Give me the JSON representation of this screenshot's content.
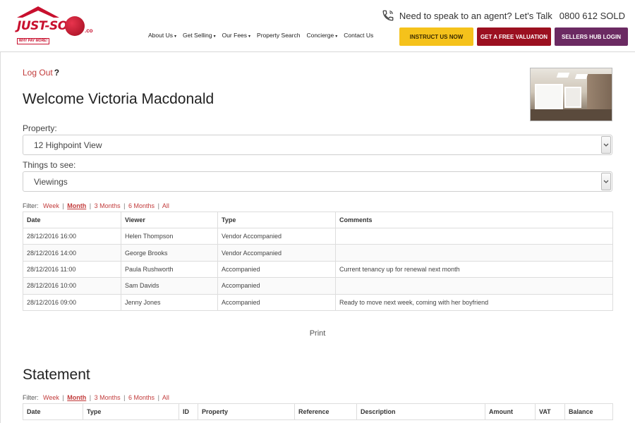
{
  "header": {
    "logo": {
      "brand": "JUST-SOLD",
      "suffix": ".co",
      "tagline": "WHY PAY MORE!"
    },
    "contact_text": "Need to speak to an agent? Let's Talk",
    "phone": "0800 612 SOLD",
    "nav": [
      {
        "label": "About Us",
        "dropdown": true
      },
      {
        "label": "Get Selling",
        "dropdown": true
      },
      {
        "label": "Our Fees",
        "dropdown": true
      },
      {
        "label": "Property Search",
        "dropdown": false
      },
      {
        "label": "Concierge",
        "dropdown": true
      },
      {
        "label": "Contact Us",
        "dropdown": false
      }
    ],
    "buttons": {
      "instruct": "INSTRUCT US NOW",
      "valuation": "GET A FREE VALUATION",
      "sellers": "SELLERS HUB LOGIN"
    }
  },
  "main": {
    "logout": "Log Out",
    "logout_help": "?",
    "welcome": "Welcome Victoria Macdonald",
    "property_label": "Property:",
    "property_value": "12 Highpoint View",
    "things_label": "Things to see:",
    "things_value": "Viewings",
    "filter": {
      "label": "Filter:",
      "options": [
        "Week",
        "Month",
        "3 Months",
        "6 Months",
        "All"
      ],
      "active": "Month"
    },
    "viewings": {
      "headers": [
        "Date",
        "Viewer",
        "Type",
        "Comments"
      ],
      "rows": [
        [
          "28/12/2016 16:00",
          "Helen Thompson",
          "Vendor Accompanied",
          ""
        ],
        [
          "28/12/2016 14:00",
          "George Brooks",
          "Vendor Accompanied",
          ""
        ],
        [
          "28/12/2016 11:00",
          "Paula Rushworth",
          "Accompanied",
          "Current tenancy up for renewal next month"
        ],
        [
          "28/12/2016 10:00",
          "Sam Davids",
          "Accompanied",
          ""
        ],
        [
          "28/12/2016 09:00",
          "Jenny Jones",
          "Accompanied",
          "Ready to move next week, coming with her boyfriend"
        ]
      ]
    },
    "print": "Print",
    "statement_title": "Statement",
    "statement_filter": {
      "label": "Filter:",
      "options": [
        "Week",
        "Month",
        "3 Months",
        "6 Months",
        "All"
      ],
      "active": "Month"
    },
    "statement": {
      "headers": [
        "Date",
        "Type",
        "ID",
        "Property",
        "Reference",
        "Description",
        "Amount",
        "VAT",
        "Balance"
      ]
    }
  },
  "colors": {
    "brand_red": "#c8102e",
    "instruct_yellow": "#f5c21b",
    "valuation_red": "#9b1020",
    "sellers_purple": "#6b2a62",
    "link_red": "#c23b3b"
  },
  "icons": {
    "phone": "phone-icon",
    "select_chevron": "chevron-down-icon"
  }
}
